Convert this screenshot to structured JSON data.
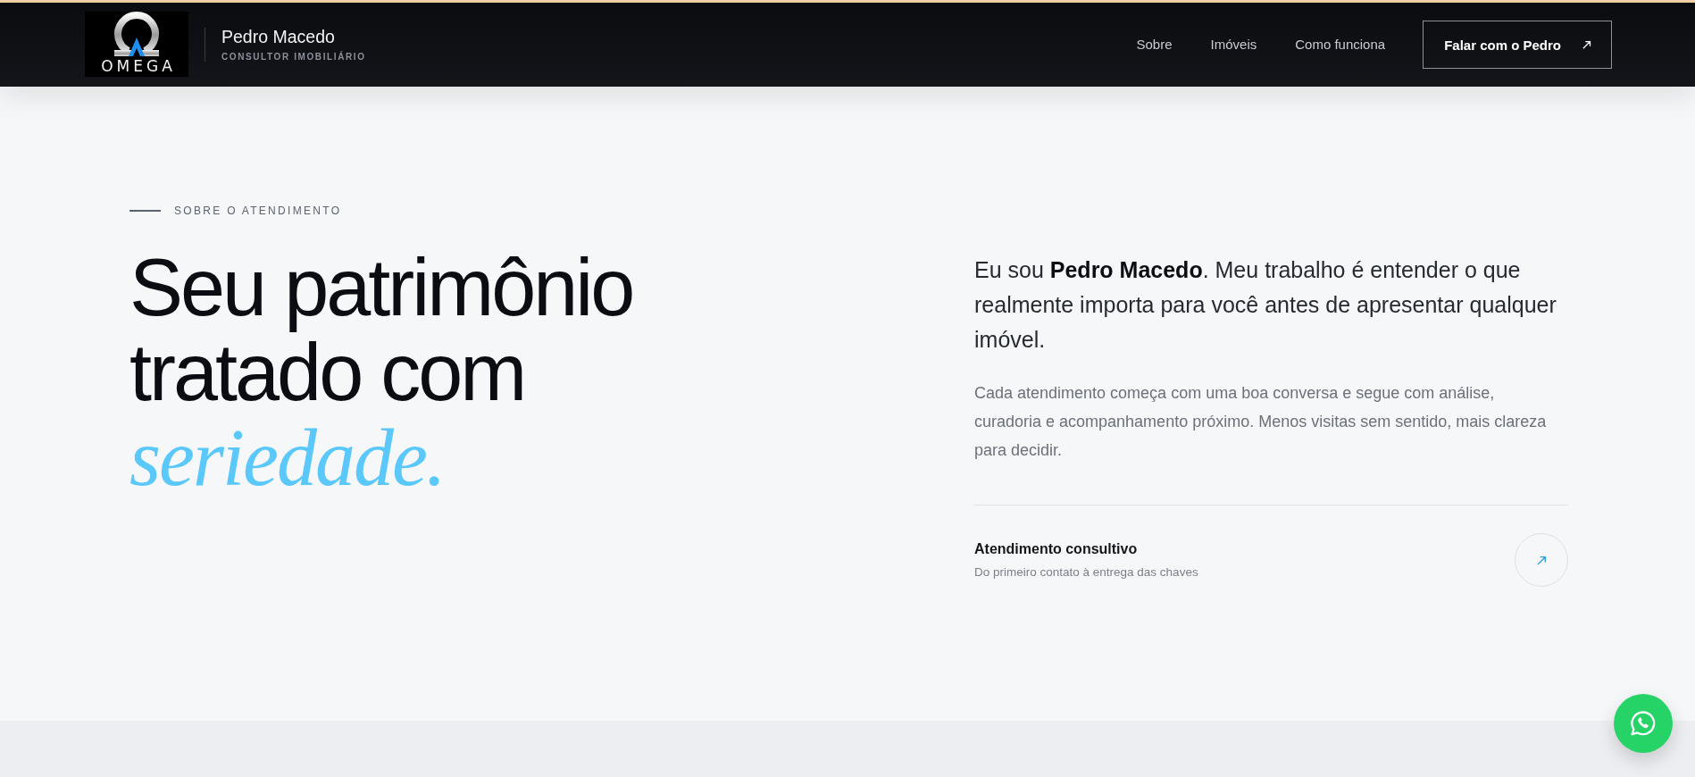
{
  "header": {
    "logo_text": "OMEGA",
    "name": "Pedro Macedo",
    "role": "CONSULTOR IMOBILIÁRIO",
    "nav": [
      {
        "label": "Sobre"
      },
      {
        "label": "Imóveis"
      },
      {
        "label": "Como funciona"
      }
    ],
    "cta": "Falar com o Pedro"
  },
  "about": {
    "eyebrow": "SOBRE O ATENDIMENTO",
    "heading": "Seu patrimônio tratado com *seriedade.*",
    "lead": "Eu sou **Pedro Macedo**. Meu trabalho é entender o que realmente importa para você antes de apresentar qualquer imóvel.",
    "body": "Cada atendimento começa com uma boa conversa e segue com análise, curadoria e acompanhamento próximo. Menos visitas sem sentido, mais clareza para decidir.",
    "feature": {
      "title": "Atendimento consultivo",
      "subtitle": "Do primeiro contato à entrega das chaves"
    }
  }
}
